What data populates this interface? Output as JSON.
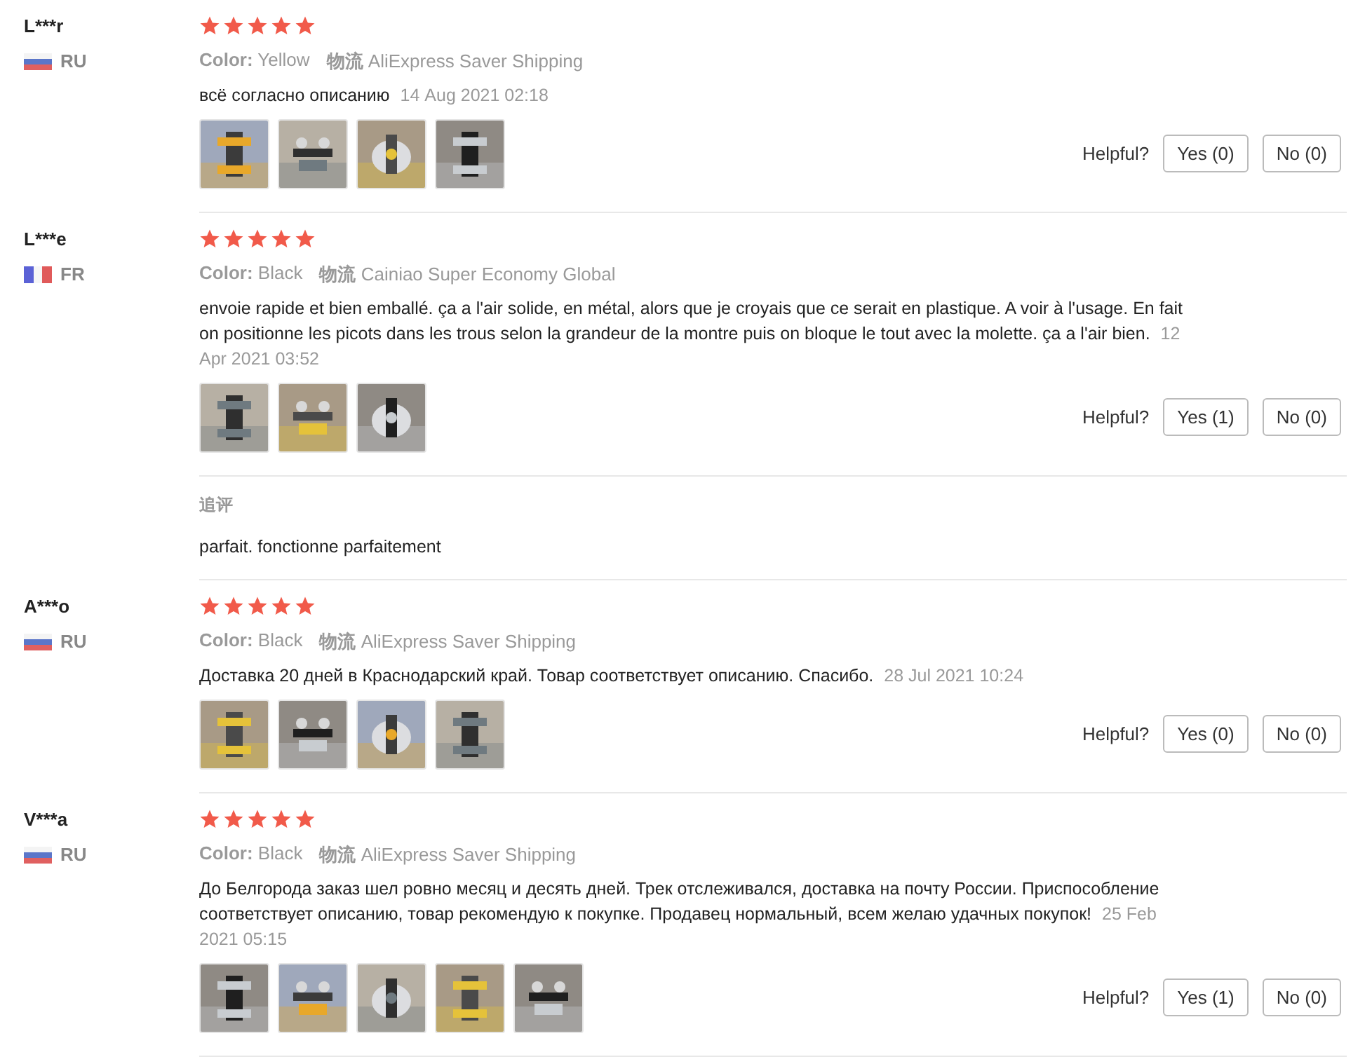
{
  "reviews": [
    {
      "user": "L***r",
      "country": "RU",
      "flag": {
        "kind": "horizontal"
      },
      "stars": 5,
      "variant_label": "Color:",
      "variant": "Yellow",
      "shipping_label": "物流",
      "shipping": "AliExpress Saver Shipping",
      "text": "всё согласно описанию",
      "date": "14 Aug 2021 02:18",
      "photos": [
        {
          "kind": "picture"
        },
        {
          "kind": "picture"
        },
        {
          "kind": "picture"
        },
        {
          "kind": "picture"
        }
      ],
      "helpful_label": "Helpful?",
      "yes": "Yes (0)",
      "no": "No (0)"
    },
    {
      "user": "L***e",
      "country": "FR",
      "flag": {
        "kind": "vertical"
      },
      "stars": 5,
      "variant_label": "Color:",
      "variant": "Black",
      "shipping_label": "物流",
      "shipping": "Cainiao Super Economy Global",
      "text": "envoie rapide et bien emballé. ça a l'air solide, en métal, alors que je croyais que ce serait en plastique. A voir à l'usage. En fait on positionne les picots dans les trous selon la grandeur de la montre puis on bloque le tout avec la molette. ça a l'air bien.",
      "date": "12 Apr 2021 03:52",
      "photos": [
        {
          "kind": "picture"
        },
        {
          "kind": "picture"
        },
        {
          "kind": "picture"
        }
      ],
      "helpful_label": "Helpful?",
      "yes": "Yes (1)",
      "no": "No (0)",
      "followup": {
        "label": "追评",
        "text": "parfait. fonctionne parfaitement"
      }
    },
    {
      "user": "A***o",
      "country": "RU",
      "flag": {
        "kind": "horizontal"
      },
      "stars": 5,
      "variant_label": "Color:",
      "variant": "Black",
      "shipping_label": "物流",
      "shipping": "AliExpress Saver Shipping",
      "text": "Доставка 20 дней в Краснодарский край. Товар соответствует описанию. Спасибо.",
      "date": "28 Jul 2021 10:24",
      "photos": [
        {
          "kind": "picture"
        },
        {
          "kind": "picture"
        },
        {
          "kind": "picture"
        },
        {
          "kind": "picture"
        }
      ],
      "helpful_label": "Helpful?",
      "yes": "Yes (0)",
      "no": "No (0)"
    },
    {
      "user": "V***a",
      "country": "RU",
      "flag": {
        "kind": "horizontal"
      },
      "stars": 5,
      "variant_label": "Color:",
      "variant": "Black",
      "shipping_label": "物流",
      "shipping": "AliExpress Saver Shipping",
      "text": "До Белгорода заказ шел ровно месяц и десять дней. Трек отслеживался, доставка на почту России. Приспособление соответствует описанию, товар рекомендую к покупке. Продавец нормальный, всем желаю удачных покупок!",
      "date": "25 Feb 2021 05:15",
      "photos": [
        {
          "kind": "picture"
        },
        {
          "kind": "picture"
        },
        {
          "kind": "picture"
        },
        {
          "kind": "picture"
        },
        {
          "kind": "picture"
        }
      ],
      "helpful_label": "Helpful?",
      "yes": "Yes (1)",
      "no": "No (0)"
    }
  ]
}
